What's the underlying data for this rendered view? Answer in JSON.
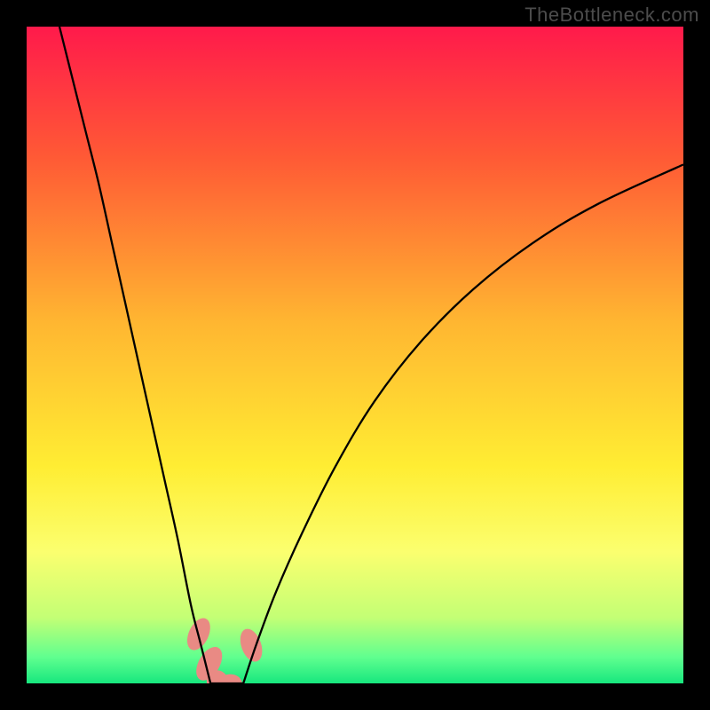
{
  "watermark": "TheBottleneck.com",
  "chart_data": {
    "type": "line",
    "title": "",
    "xlabel": "",
    "ylabel": "",
    "xlim": [
      0,
      100
    ],
    "ylim": [
      0,
      100
    ],
    "background_gradient": {
      "stops": [
        {
          "offset": 0,
          "color": "#ff1a4b"
        },
        {
          "offset": 20,
          "color": "#ff5a35"
        },
        {
          "offset": 45,
          "color": "#ffb631"
        },
        {
          "offset": 67,
          "color": "#ffed33"
        },
        {
          "offset": 80,
          "color": "#fbff6f"
        },
        {
          "offset": 90,
          "color": "#c3ff75"
        },
        {
          "offset": 96,
          "color": "#60ff8f"
        },
        {
          "offset": 100,
          "color": "#17e77e"
        }
      ]
    },
    "series": [
      {
        "name": "left-branch",
        "x": [
          5,
          7,
          9,
          11,
          13,
          15,
          17,
          19,
          21,
          23,
          25,
          26.5,
          28
        ],
        "y": [
          100,
          92,
          84,
          76,
          67,
          58,
          49,
          40,
          31,
          22,
          12,
          6,
          0
        ]
      },
      {
        "name": "right-branch",
        "x": [
          33,
          35,
          38,
          42,
          47,
          53,
          60,
          68,
          77,
          87,
          100
        ],
        "y": [
          0,
          6,
          14,
          23,
          33,
          43,
          52,
          60,
          67,
          73,
          79
        ]
      },
      {
        "name": "valley",
        "x": [
          28,
          29,
          30,
          31,
          32,
          33
        ],
        "y": [
          0,
          0,
          0,
          0,
          0,
          0
        ]
      }
    ],
    "markers": [
      {
        "name": "blob-left-upper",
        "cx": 26.2,
        "cy": 7.5,
        "rx": 1.5,
        "ry": 2.6,
        "rot": 25,
        "color": "#e98a84"
      },
      {
        "name": "blob-left-lower",
        "cx": 27.8,
        "cy": 3.0,
        "rx": 1.6,
        "ry": 2.8,
        "rot": 30,
        "color": "#e98a84"
      },
      {
        "name": "blob-bottom-1",
        "cx": 29.0,
        "cy": 0.4,
        "rx": 1.6,
        "ry": 1.6,
        "rot": 0,
        "color": "#e98a84"
      },
      {
        "name": "blob-bottom-2",
        "cx": 31.0,
        "cy": 0.0,
        "rx": 1.8,
        "ry": 1.4,
        "rot": 0,
        "color": "#e98a84"
      },
      {
        "name": "blob-right",
        "cx": 34.2,
        "cy": 5.8,
        "rx": 1.5,
        "ry": 2.6,
        "rot": -20,
        "color": "#e98a84"
      }
    ]
  }
}
